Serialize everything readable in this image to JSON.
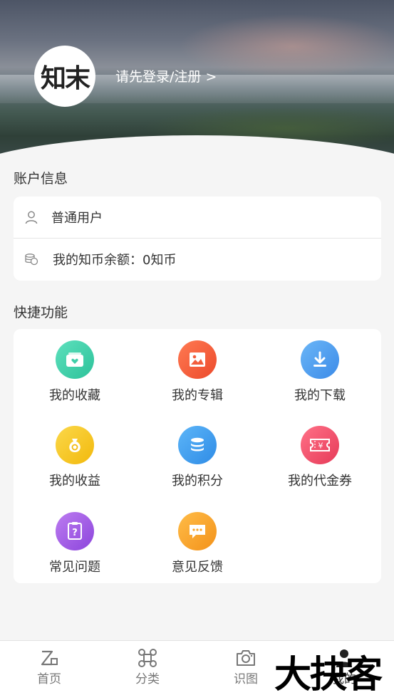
{
  "header": {
    "avatar_text": "知末",
    "login_text": "请先登录/注册 >"
  },
  "account": {
    "title": "账户信息",
    "user_type": "普通用户",
    "balance": "我的知币余额：0知币"
  },
  "quick": {
    "title": "快捷功能",
    "items": [
      {
        "label": "我的收藏",
        "color": "#3fcfa9",
        "icon": "collection-icon"
      },
      {
        "label": "我的专辑",
        "color": "#f25d3c",
        "icon": "album-icon"
      },
      {
        "label": "我的下载",
        "color": "#4a9cf0",
        "icon": "download-icon"
      },
      {
        "label": "我的收益",
        "color": "#f7c81e",
        "icon": "money-bag-icon"
      },
      {
        "label": "我的积分",
        "color": "#3f9ef0",
        "icon": "points-icon"
      },
      {
        "label": "我的代金券",
        "color": "#f0506a",
        "icon": "voucher-icon"
      },
      {
        "label": "常见问题",
        "color": "#a35ee6",
        "icon": "faq-icon"
      },
      {
        "label": "意见反馈",
        "color": "#f8a326",
        "icon": "feedback-icon"
      }
    ]
  },
  "tabbar": {
    "items": [
      {
        "label": "首页",
        "icon": "home-icon"
      },
      {
        "label": "分类",
        "icon": "category-icon"
      },
      {
        "label": "识图",
        "icon": "camera-icon"
      },
      {
        "label": "我的",
        "icon": "profile-icon"
      }
    ]
  },
  "watermark": "大抉客"
}
